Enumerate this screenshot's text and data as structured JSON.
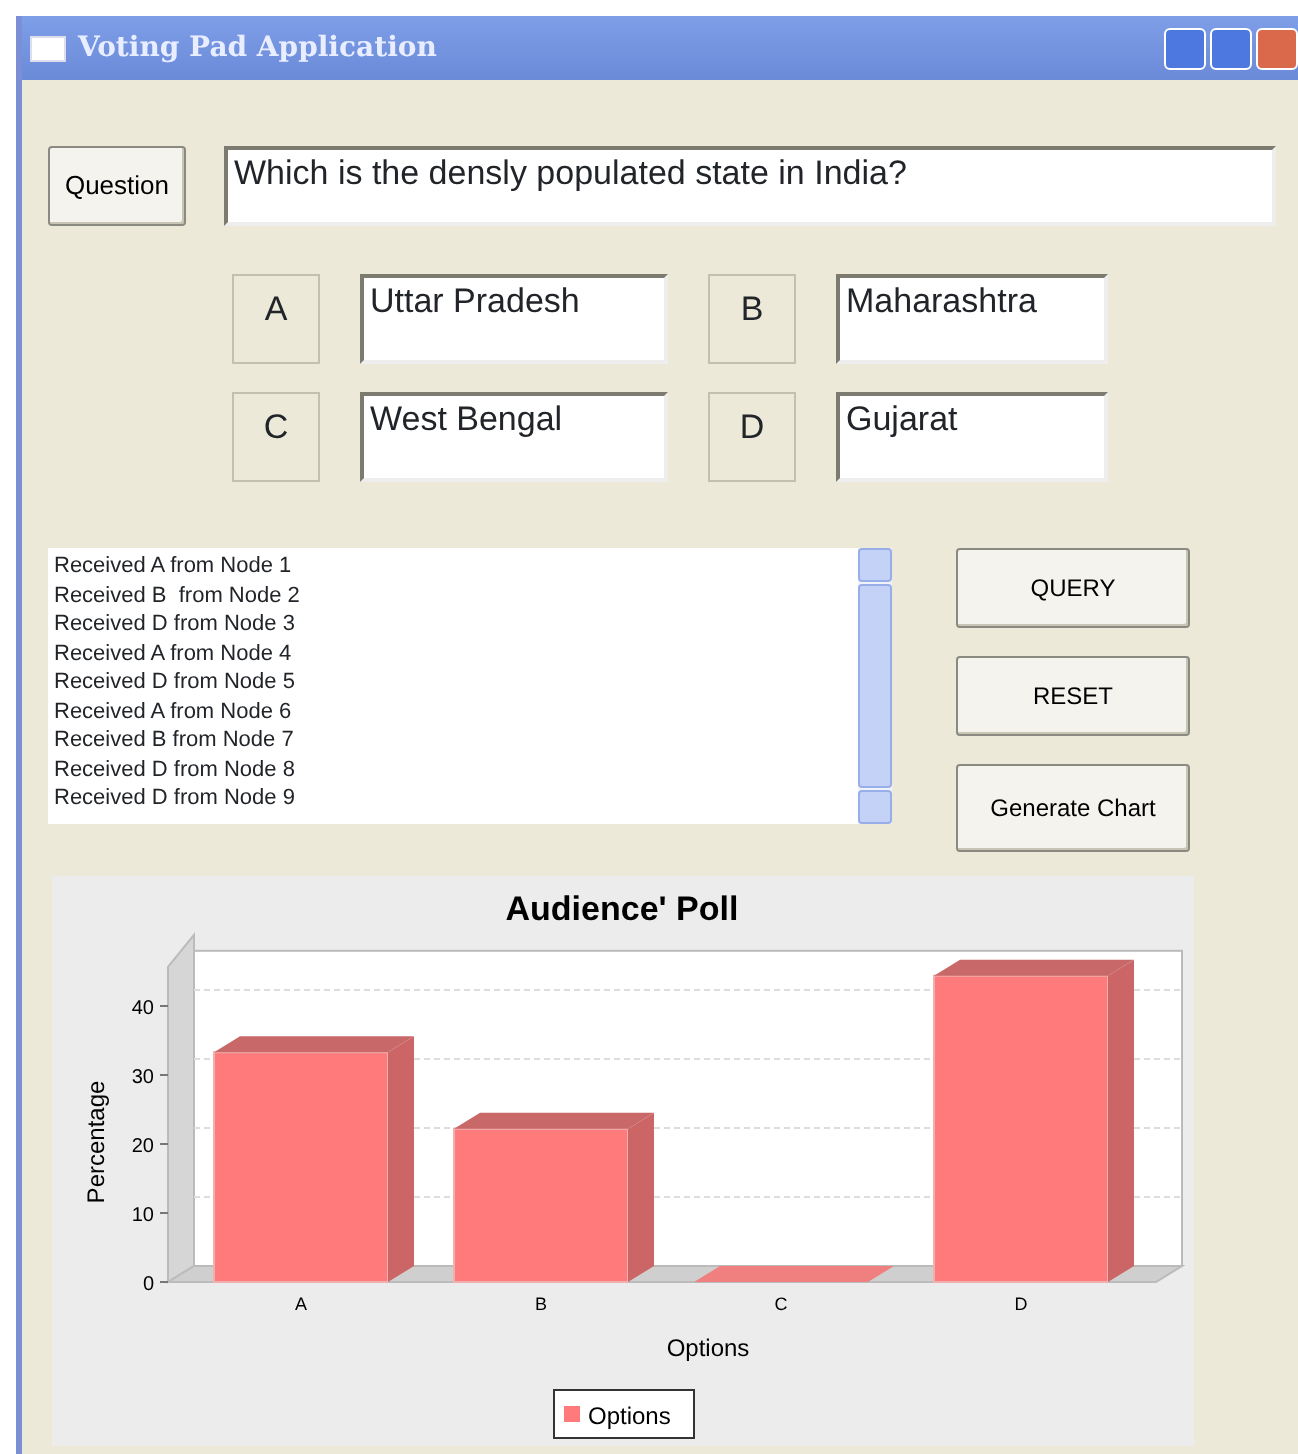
{
  "window": {
    "title": "Voting Pad Application"
  },
  "question": {
    "button": "Question",
    "text": "Which is the densly populated state in India?"
  },
  "options": [
    {
      "letter": "A",
      "answer": "Uttar Pradesh"
    },
    {
      "letter": "B",
      "answer": "Maharashtra"
    },
    {
      "letter": "C",
      "answer": "West Bengal"
    },
    {
      "letter": "D",
      "answer": "Gujarat"
    }
  ],
  "log": [
    "Received A from Node 1",
    "Received B  from Node 2",
    "Received D from Node 3",
    "Received A from Node 4",
    "Received D from Node 5",
    "Received A from Node 6",
    "Received B from Node 7",
    "Received D from Node 8",
    "Received D from Node 9"
  ],
  "buttons": [
    "QUERY",
    "RESET",
    "Generate Chart"
  ],
  "chart": {
    "chart_data": {
      "type": "bar",
      "title": "Audience' Poll",
      "xlabel": "Options",
      "ylabel": "Percentage",
      "categories": [
        "A",
        "B",
        "C",
        "D"
      ],
      "series": [
        {
          "name": "Options",
          "color": "#ff7b7b",
          "values": [
            33.3,
            22.2,
            0,
            44.4
          ]
        }
      ],
      "ylim": [
        0,
        48
      ],
      "yticks": [
        0,
        10,
        20,
        30,
        40
      ]
    }
  }
}
